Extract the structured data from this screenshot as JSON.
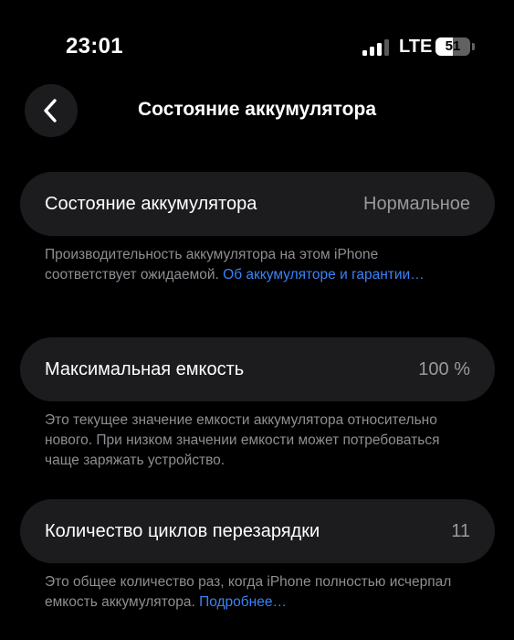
{
  "status_bar": {
    "time": "23:01",
    "network": "LTE",
    "battery_level": "51",
    "battery_fraction": 0.51,
    "signal_bars_active": 3,
    "signal_bars_total": 4
  },
  "header": {
    "back_icon": "chevron-left-icon",
    "title": "Состояние аккумулятора"
  },
  "sections": {
    "health": {
      "label": "Состояние аккумулятора",
      "value": "Нормальное",
      "footnote_text": "Производительность аккумулятора на этом iPhone соответствует ожидаемой. ",
      "footnote_link": "Об аккумуляторе и гарантии…"
    },
    "capacity": {
      "label": "Максимальная емкость",
      "value": "100 %",
      "footnote_text": "Это текущее значение емкости аккумулятора относительно нового. При низком значении емкости может потребоваться чаще заряжать устройство."
    },
    "cycles": {
      "label": "Количество циклов перезарядки",
      "value": "11",
      "footnote_text": "Это общее количество раз, когда iPhone полностью исчерпал емкость аккумулятора. ",
      "footnote_link": "Подробнее…"
    }
  },
  "colors": {
    "background": "#000000",
    "card": "#1c1c1e",
    "secondary_text": "#8e8e93",
    "link": "#3b82f6"
  }
}
